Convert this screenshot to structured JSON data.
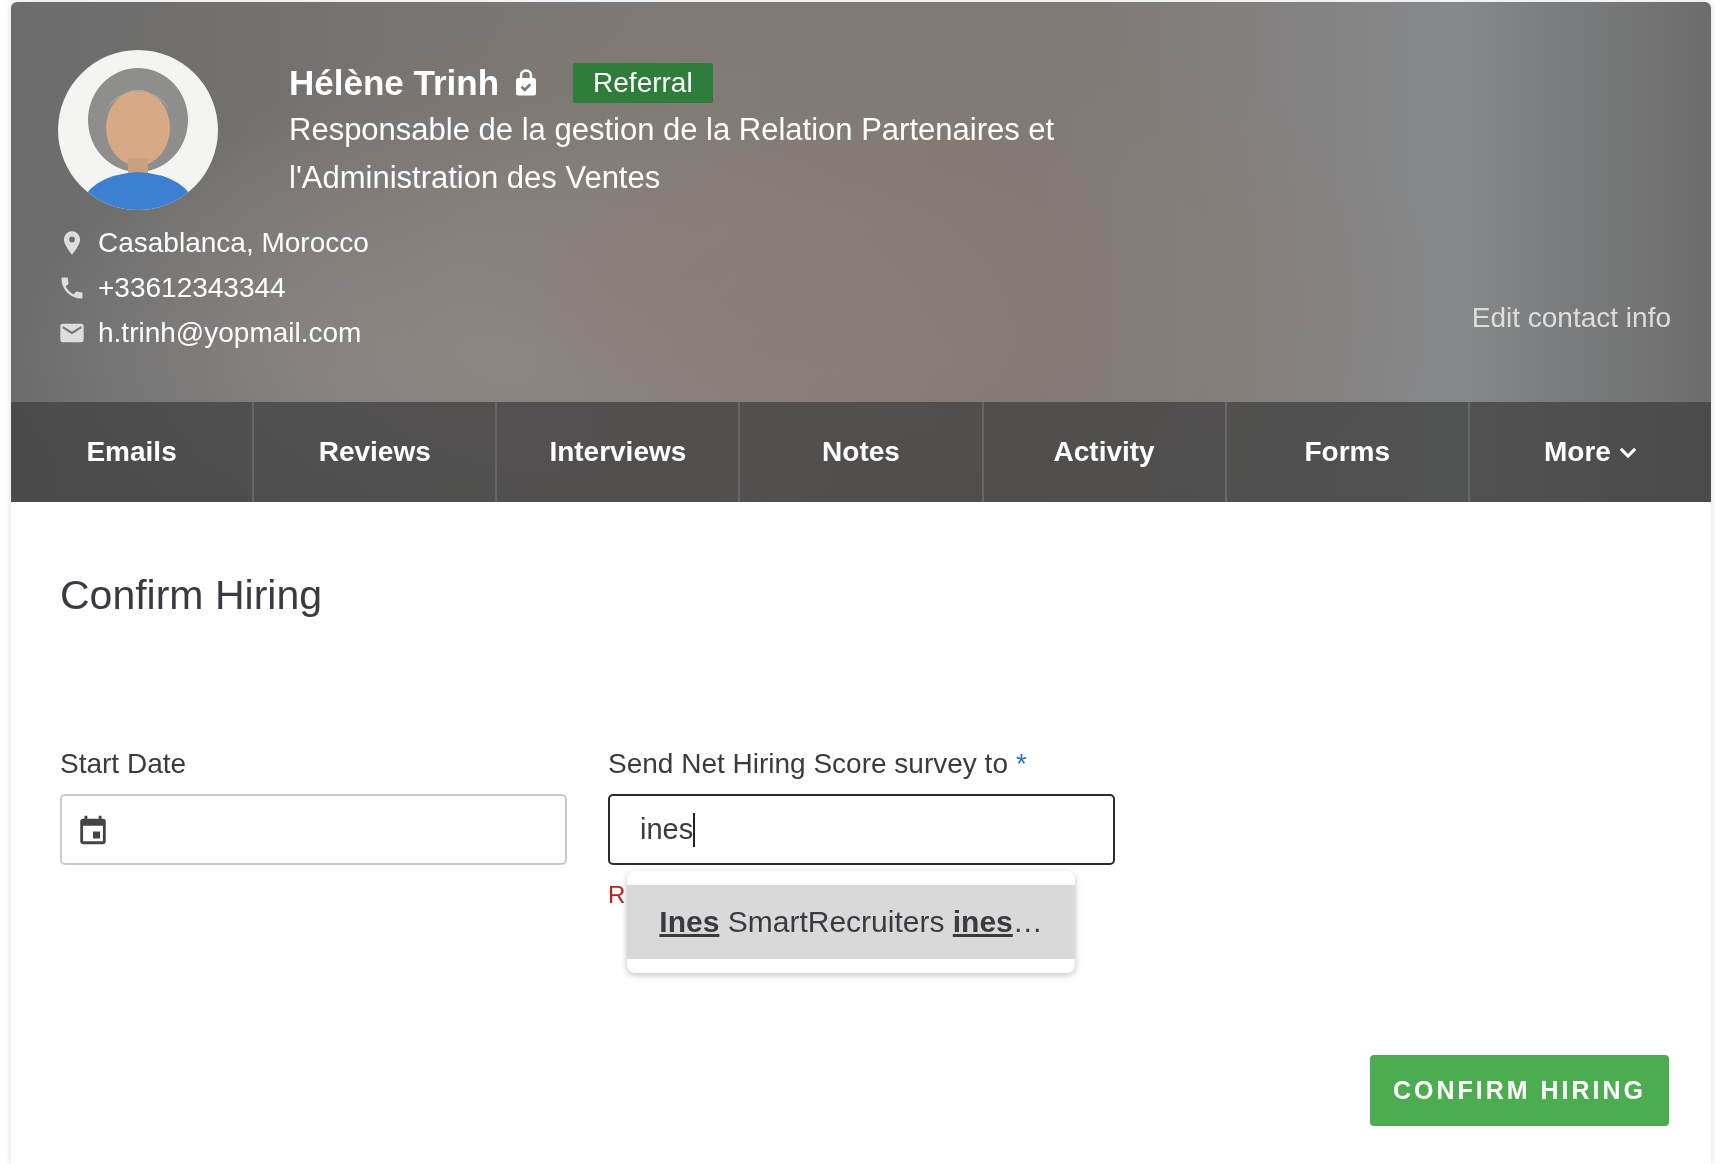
{
  "profile": {
    "name": "Hélène Trinh",
    "badge": "Referral",
    "title": "Responsable de la gestion de la Relation Partenaires et l'Administration des Ventes",
    "contacts": [
      {
        "kind": "location",
        "text": "Casablanca, Morocco"
      },
      {
        "kind": "phone",
        "text": "+33612343344"
      },
      {
        "kind": "email",
        "text": "h.trinh@yopmail.com"
      }
    ],
    "edit_link": "Edit contact info"
  },
  "tabs": [
    {
      "label": "Emails",
      "has_menu": false
    },
    {
      "label": "Reviews",
      "has_menu": false
    },
    {
      "label": "Interviews",
      "has_menu": false
    },
    {
      "label": "Notes",
      "has_menu": false
    },
    {
      "label": "Activity",
      "has_menu": false
    },
    {
      "label": "Forms",
      "has_menu": false
    },
    {
      "label": "More",
      "has_menu": true
    }
  ],
  "form": {
    "heading": "Confirm Hiring",
    "start_date": {
      "label": "Start Date"
    },
    "survey": {
      "label": "Send Net Hiring Score survey to",
      "required_mark": "*",
      "value": "ines",
      "error": "R",
      "suggestions": [
        "**Ines** SmartRecruiters **ines**…"
      ]
    },
    "submit": "CONFIRM HIRING"
  }
}
